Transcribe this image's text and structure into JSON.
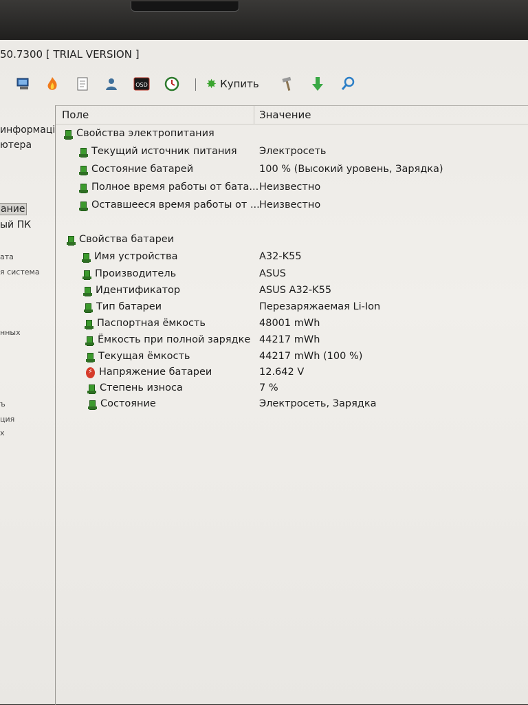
{
  "window": {
    "title": "50.7300  [ TRIAL VERSION ]"
  },
  "toolbar": {
    "icons": [
      "computer-icon",
      "flame-icon",
      "report-icon",
      "user-icon",
      "osd-icon",
      "timer-icon"
    ],
    "osd_label": "OSD",
    "buy_label": "Купить",
    "tools_icon": "hammer-icon",
    "download_icon": "arrow-down-icon",
    "search_icon": "search-icon"
  },
  "sidebar": {
    "items": [
      {
        "label": "информаці"
      },
      {
        "label": "ютера"
      },
      {
        "label": "ание"
      },
      {
        "label": "ый ПК"
      },
      {
        "label": "ата"
      },
      {
        "label": "я система"
      },
      {
        "label": "нных"
      },
      {
        "label": "ъ"
      },
      {
        "label": "ция"
      },
      {
        "label": "х"
      }
    ]
  },
  "table": {
    "columns": [
      "Поле",
      "Значение"
    ],
    "groups": [
      {
        "label": "Свойства электропитания",
        "rows": [
          {
            "field": "Текущий источник питания",
            "value": "Электросеть",
            "icon": "battery-icon"
          },
          {
            "field": "Состояние батарей",
            "value": "100 % (Высокий уровень, Зарядка)",
            "icon": "battery-icon"
          },
          {
            "field": "Полное время работы от бата...",
            "value": "Неизвестно",
            "icon": "battery-icon"
          },
          {
            "field": "Оставшееся время работы от ...",
            "value": "Неизвестно",
            "icon": "battery-icon"
          }
        ]
      },
      {
        "label": "Свойства батареи",
        "rows": [
          {
            "field": "Имя устройства",
            "value": "A32-K55",
            "icon": "battery-icon"
          },
          {
            "field": "Производитель",
            "value": "ASUS",
            "icon": "battery-icon"
          },
          {
            "field": "Идентификатор",
            "value": "ASUS A32-K55",
            "icon": "battery-icon"
          },
          {
            "field": "Тип батареи",
            "value": "Перезаряжаемая Li-Ion",
            "icon": "battery-icon"
          },
          {
            "field": "Паспортная ёмкость",
            "value": "48001 mWh",
            "icon": "battery-icon"
          },
          {
            "field": "Ёмкость при полной зарядке",
            "value": "44217 mWh",
            "icon": "battery-icon"
          },
          {
            "field": "Текущая ёмкость",
            "value": "44217 mWh  (100 %)",
            "icon": "battery-icon"
          },
          {
            "field": "Напряжение батареи",
            "value": "12.642 V",
            "icon": "voltage-icon"
          },
          {
            "field": "Степень износа",
            "value": "7 %",
            "icon": "battery-icon"
          },
          {
            "field": "Состояние",
            "value": "Электросеть, Зарядка",
            "icon": "battery-icon"
          }
        ]
      }
    ]
  },
  "colors": {
    "accent_green": "#3c9a2d",
    "voltage_red": "#d63b2a"
  }
}
